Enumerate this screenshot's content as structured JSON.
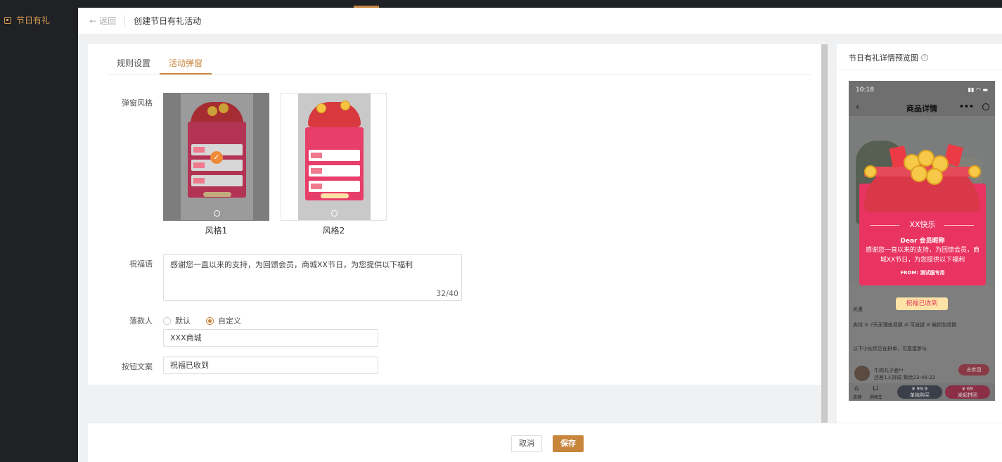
{
  "sidebar": {
    "item_label": "节日有礼"
  },
  "header": {
    "back_label": "返回",
    "title": "创建节日有礼活动"
  },
  "tabs": [
    {
      "label": "规则设置",
      "active": false
    },
    {
      "label": "活动弹窗",
      "active": true
    }
  ],
  "form": {
    "style": {
      "label": "弹窗风格",
      "options": [
        {
          "caption": "风格1",
          "selected": true
        },
        {
          "caption": "风格2",
          "selected": false
        }
      ]
    },
    "greeting": {
      "label": "祝福语",
      "value": "感谢您一直以来的支持，为回馈会员，商城XX节日，为您提供以下福利",
      "counter": "32/40"
    },
    "signer": {
      "label": "落款人",
      "options": [
        {
          "label": "默认",
          "checked": false
        },
        {
          "label": "自定义",
          "checked": true
        }
      ],
      "value": "XXX商城"
    },
    "button_text": {
      "label": "按钮文案",
      "value": "祝福已收到"
    }
  },
  "footer": {
    "cancel_label": "取消",
    "save_label": "保存"
  },
  "preview": {
    "title": "节日有礼详情预览图",
    "phone": {
      "time": "10:18",
      "nav_title": "商品详情",
      "nav_more": "•••",
      "popup": {
        "title": "XX快乐",
        "dear": "Dear 会员昵称",
        "message": "感谢您一直以来的支持，为回馈会员，商城XX节日，为您提供以下福利",
        "from_label": "FROM:",
        "from_value": "测试服专用",
        "button": "祝福已收到"
      },
      "body_lines": [
        "优惠",
        "支持 ⊘ 7天无理由退换 ⊘ 可自提 ⊘ 破损包退换",
        "以下小伙伴正在拼单，可直接参与",
        "牛肉丸子面**",
        "还差1人拼成 剩余23:46:22"
      ],
      "join_label": "去参团",
      "buy_single": "¥ 99.9\n单独购买",
      "buy_group": "¥ 69\n发起拼团",
      "home_label": "店铺",
      "cart_label": "购物车"
    }
  },
  "colors": {
    "accent": "#c8853c",
    "popup_pink": "#e93360",
    "sidebar_bg": "#1f2125"
  }
}
